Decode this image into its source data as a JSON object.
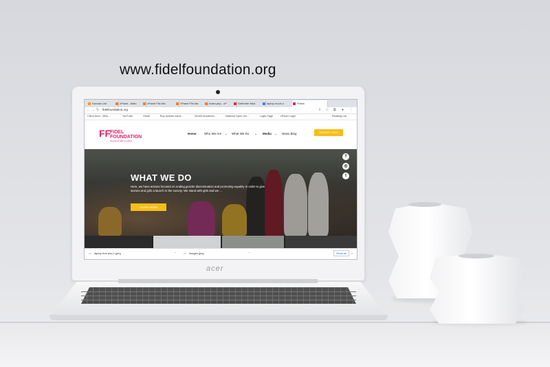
{
  "heading": "www.fidelfoundation.org",
  "laptop_brand": "acer",
  "browser": {
    "tabs": [
      {
        "label": "Domain List"
      },
      {
        "label": "cPanel - Main"
      },
      {
        "label": "cPanel File Ma"
      },
      {
        "label": "cPanel File Ma"
      },
      {
        "label": "Index.php - cP"
      },
      {
        "label": "Defender Mod"
      },
      {
        "label": "laptop mock-u"
      },
      {
        "label": "Fidelo"
      }
    ],
    "address": "fidelfoundation.org",
    "bookmarks": [
      {
        "label": "Client Area - Wha..."
      },
      {
        "label": "YouTube"
      },
      {
        "label": "Gmail"
      },
      {
        "label": "Buy domain name..."
      },
      {
        "label": "NOUN Academic..."
      },
      {
        "label": "National Open Uni..."
      },
      {
        "label": "Login Page"
      },
      {
        "label": "cPanel Login"
      },
      {
        "label": "Reading List"
      }
    ]
  },
  "site": {
    "logo_mark": "FF",
    "logo_line1": "FIDEL",
    "logo_line2": "FOUNDATION",
    "tagline": "Rewriting HER narrative",
    "menu": [
      {
        "label": "Home"
      },
      {
        "label": "Who We Are"
      },
      {
        "label": "What We Do"
      },
      {
        "label": "Media"
      },
      {
        "label": "News Blog"
      }
    ],
    "donate_label": "DONATE NOW",
    "hero": {
      "title": "WHAT WE DO",
      "body": "Here, we have actions focused on ending gender discrimination and promoting equality in order to give women and girls a launch in the society. We stand with girls and we ...",
      "button": "LEARN MORE",
      "social": [
        "f",
        "◎",
        "t"
      ]
    }
  },
  "downloads": [
    {
      "label": "laptop free psd-1.jpeg"
    },
    {
      "label": "images.jpeg"
    }
  ],
  "show_all": "Show all",
  "colors": {
    "brand_pink": "#e0236a",
    "accent_yellow": "#f7bd18"
  }
}
